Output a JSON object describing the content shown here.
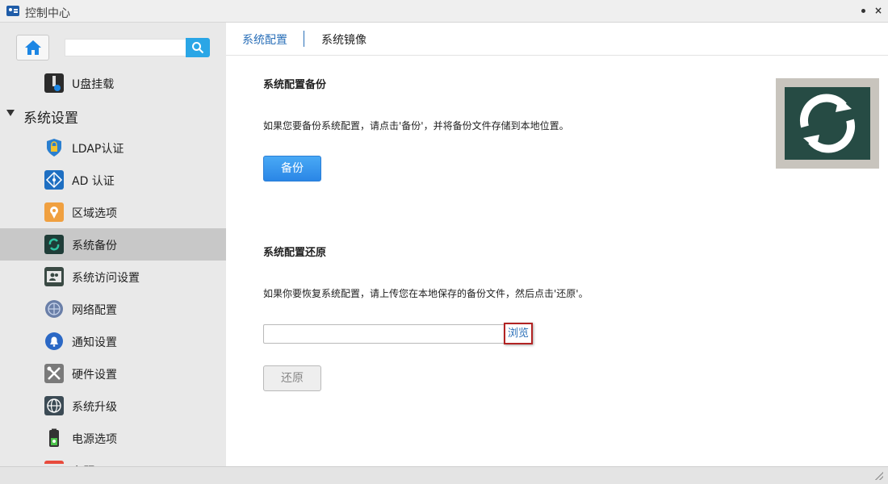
{
  "window": {
    "title": "控制中心"
  },
  "sidebar": {
    "search": {
      "value": "",
      "placeholder": ""
    },
    "items_top": [
      {
        "label": "U盘挂载",
        "icon": "usb-icon"
      }
    ],
    "section": {
      "label": "系统设置"
    },
    "items": [
      {
        "label": "LDAP认证",
        "icon": "ldap-shield-icon"
      },
      {
        "label": "AD 认证",
        "icon": "ad-network-icon"
      },
      {
        "label": "区域选项",
        "icon": "region-icon"
      },
      {
        "label": "系统备份",
        "icon": "backup-icon",
        "active": true
      },
      {
        "label": "系统访问设置",
        "icon": "access-icon"
      },
      {
        "label": "网络配置",
        "icon": "network-icon"
      },
      {
        "label": "通知设置",
        "icon": "bell-icon"
      },
      {
        "label": "硬件设置",
        "icon": "tools-icon"
      },
      {
        "label": "系统升级",
        "icon": "globe-icon"
      },
      {
        "label": "电源选项",
        "icon": "battery-icon"
      },
      {
        "label": "主题",
        "icon": "theme-icon"
      }
    ]
  },
  "tabs": [
    {
      "label": "系统配置",
      "active": true
    },
    {
      "label": "系统镜像",
      "active": false
    }
  ],
  "backup": {
    "title": "系统配置备份",
    "description": "如果您要备份系统配置，请点击'备份'，并将备份文件存储到本地位置。",
    "button": "备份"
  },
  "restore": {
    "title": "系统配置还原",
    "description": "如果你要恢复系统配置，请上传您在本地保存的备份文件，然后点击'还原'。",
    "file_value": "",
    "browse": "浏览",
    "button": "还原"
  },
  "colors": {
    "accent": "#2a86e6",
    "tab_active": "#2a6fb8",
    "highlight_border": "#b22323"
  }
}
